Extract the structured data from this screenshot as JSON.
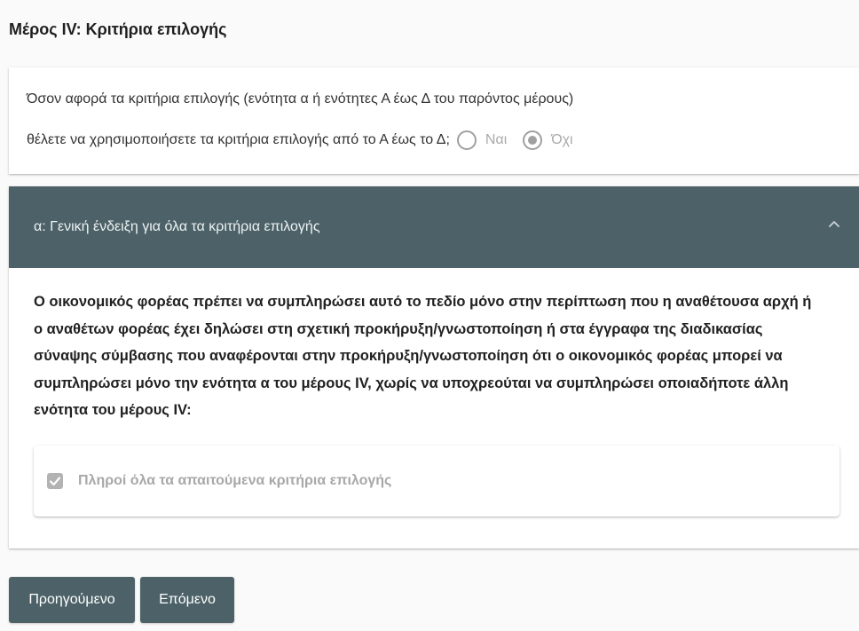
{
  "page": {
    "title": "Μέρος IV: Κριτήρια επιλογής"
  },
  "selection_criteria": {
    "intro": "Όσον αφορά τα κριτήρια επιλογής (ενότητα α ή ενότητες Α έως Δ του παρόντος μέρους)",
    "question": "θέλετε να χρησιμοποιήσετε τα κριτήρια επιλογής από το Α έως το Δ;",
    "disabled": true,
    "options": [
      {
        "label": "Ναι",
        "checked": false
      },
      {
        "label": "Όχι",
        "checked": true
      }
    ]
  },
  "section_alpha": {
    "title": "α: Γενική ένδειξη για όλα τα κριτήρια επιλογής",
    "expanded": true,
    "toggle_icon": "chevron-up-icon",
    "description_lines": [
      "Ο οικονομικός φορέας πρέπει να συμπληρώσει αυτό το πεδίο μόνο στην περίπτωση που η αναθέτουσα αρχή ή",
      "ο αναθέτων φορέας έχει δηλώσει στη σχετική προκήρυξη/γνωστοποίηση ή στα έγγραφα της διαδικασίας",
      "σύναψης σύμβασης που αναφέρονται στην προκήρυξη/γνωστοποίηση ότι ο οικονομικός φορέας μπορεί να",
      "συμπληρώσει μόνο την ενότητα α του μέρους IV, χωρίς να υποχρεούται να συμπληρώσει οποιαδήποτε άλλη",
      "ενότητα του μέρους IV:"
    ],
    "criterion": {
      "label": "Πληροί όλα τα απαιτούμενα κριτήρια επιλογής",
      "checked": true,
      "disabled": true,
      "icon": "checkbox-checked-icon"
    }
  },
  "navigation": {
    "previous_label": "Προηγούμενο",
    "next_label": "Επόμενο"
  },
  "colors": {
    "accent": "#4d6268",
    "disabled": "#a0a0a0",
    "text": "#212121"
  }
}
